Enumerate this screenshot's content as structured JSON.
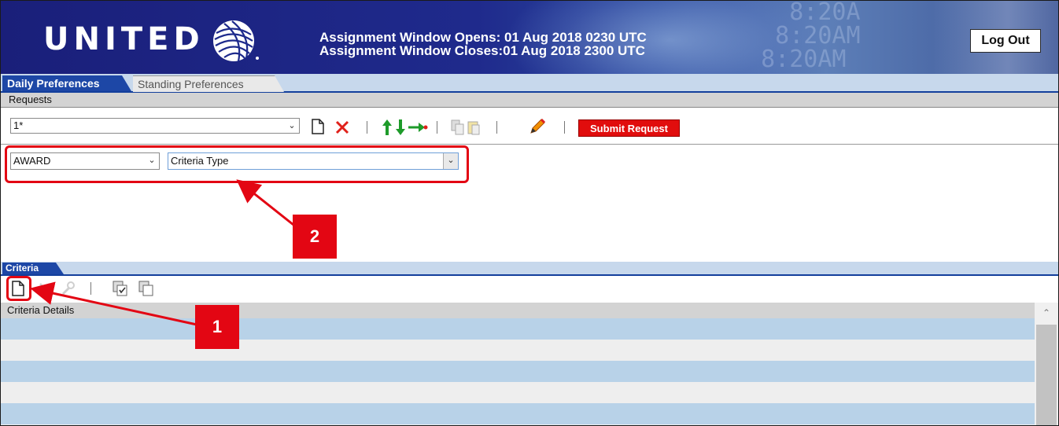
{
  "header": {
    "logo_text": "UNITED",
    "window_opens": "Assignment Window Opens: 01 Aug 2018 0230 UTC",
    "window_closes": "Assignment Window Closes:01 Aug 2018 2300 UTC",
    "logout_label": "Log Out"
  },
  "tabs": [
    {
      "label": "Daily Preferences",
      "active": true
    },
    {
      "label": "Standing Preferences",
      "active": false
    }
  ],
  "requests": {
    "section_label": "Requests",
    "selected_request": "1*",
    "submit_label": "Submit Request",
    "toolbar_icons": [
      "new-document-icon",
      "delete-icon",
      "move-up-icon",
      "move-down-icon",
      "move-right-icon",
      "copy-icon",
      "paste-icon",
      "edit-pencil-icon"
    ]
  },
  "criteria_selectors": {
    "award_value": "AWARD",
    "criteria_type_placeholder": "Criteria Type"
  },
  "criteria": {
    "tab_label": "Criteria",
    "details_header": "Criteria Details",
    "toolbar_icons": [
      "new-criteria-icon",
      "delete-criteria-icon",
      "settings-icon",
      "copy-criteria-icon",
      "duplicate-icon"
    ]
  },
  "annotations": [
    {
      "number": "1"
    },
    {
      "number": "2"
    }
  ],
  "colors": {
    "accent_blue": "#1d47a6",
    "submit_red": "#e10d0d",
    "callout_red": "#e30613",
    "row_blue": "#b8d2e8",
    "row_gray": "#eeeeee"
  }
}
